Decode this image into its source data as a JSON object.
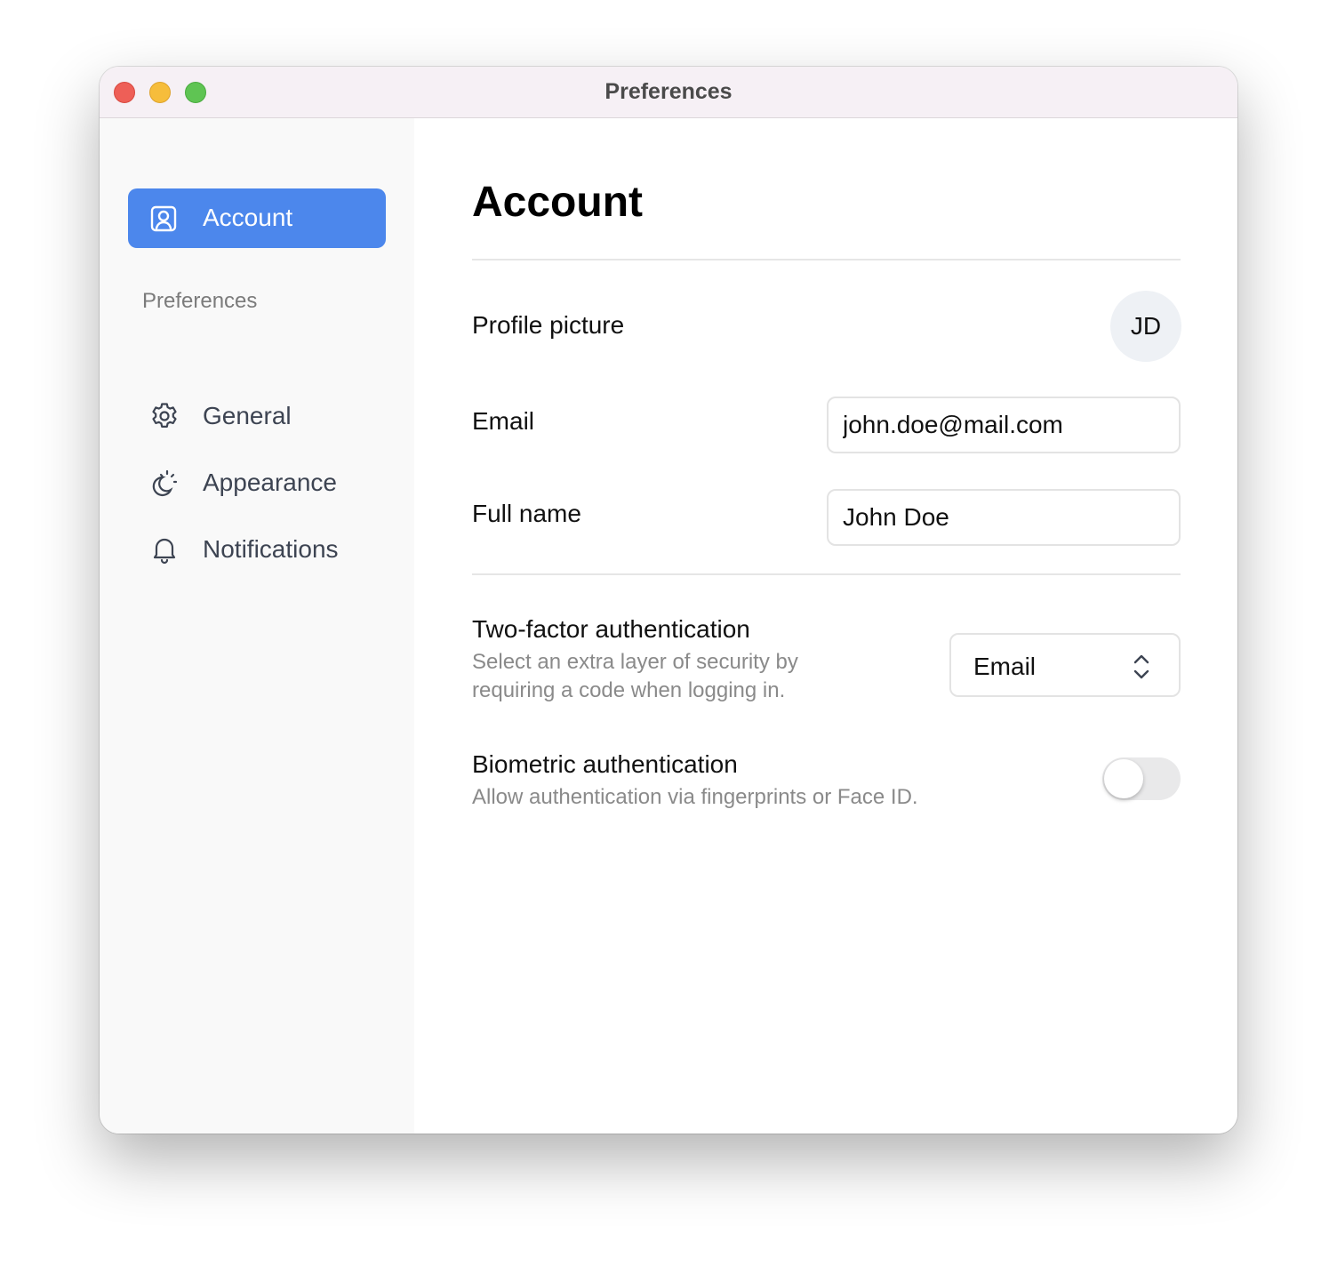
{
  "window": {
    "title": "Preferences"
  },
  "sidebar": {
    "active_item": {
      "label": "Account",
      "icon": "user-square-icon"
    },
    "section_label": "Preferences",
    "items": [
      {
        "label": "General",
        "icon": "gear-icon"
      },
      {
        "label": "Appearance",
        "icon": "sun-moon-icon"
      },
      {
        "label": "Notifications",
        "icon": "bell-icon"
      }
    ]
  },
  "main": {
    "title": "Account",
    "profile_picture": {
      "label": "Profile picture",
      "initials": "JD"
    },
    "email": {
      "label": "Email",
      "value": "john.doe@mail.com"
    },
    "full_name": {
      "label": "Full name",
      "value": "John Doe"
    },
    "two_factor": {
      "label": "Two-factor authentication",
      "description_line1": "Select an extra layer of security by",
      "description_line2": "requiring a code when logging in.",
      "selected": "Email"
    },
    "biometric": {
      "label": "Biometric authentication",
      "description": "Allow authentication via fingerprints or Face ID.",
      "enabled": false
    }
  },
  "colors": {
    "accent": "#4c87ec",
    "close": "#ee5f57",
    "minimize": "#f6bd3b",
    "maximize": "#5fc453"
  }
}
